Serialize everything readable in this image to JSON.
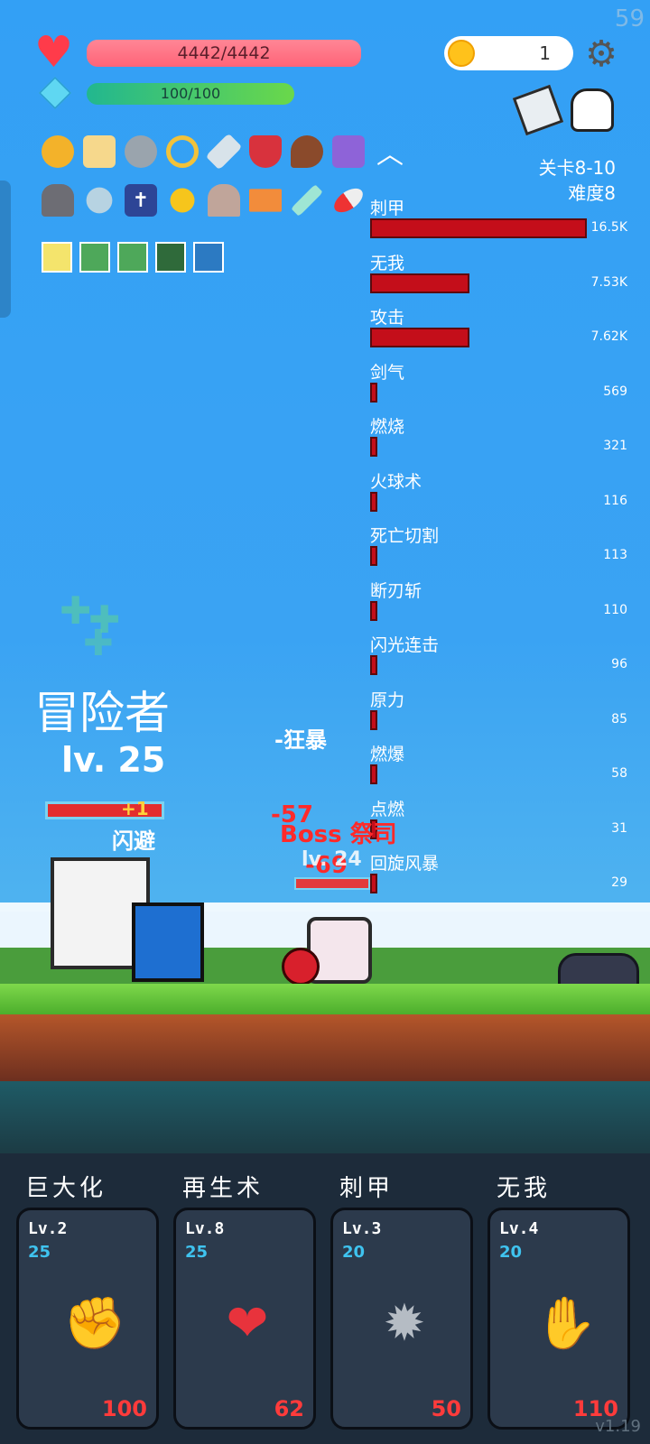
{
  "fps": "59",
  "player": {
    "hp_text": "4442/4442",
    "mp_text": "100/100",
    "hp_fraction": 1.0,
    "mp_fraction": 1.0
  },
  "coins": "1",
  "stage": {
    "level": "关卡8-10",
    "difficulty": "难度8"
  },
  "equipment_row1": [
    "coin-stack-icon",
    "scroll-icon",
    "spiked-mace-icon",
    "ring-icon",
    "sword-icon",
    "shield-icon",
    "drumstick-icon",
    "treasure-chest-icon",
    "collapse-chevron-icon"
  ],
  "equipment_row2": [
    "helmet-icon",
    "clover-icon",
    "holy-book-icon",
    "sun-orb-icon",
    "tombstone-icon",
    "crown-icon",
    "dagger-icon",
    "pill-icon"
  ],
  "buff_icons": [
    "light-burst-icon",
    "sprout-icon",
    "sprout-icon",
    "wind-swirl-icon",
    "sparkle-icon"
  ],
  "damage_stats": [
    {
      "name": "刺甲",
      "value": "16.5K",
      "fraction": 1.0
    },
    {
      "name": "无我",
      "value": "7.53K",
      "fraction": 0.46
    },
    {
      "name": "攻击",
      "value": "7.62K",
      "fraction": 0.46
    },
    {
      "name": "剑气",
      "value": "569",
      "fraction": 0.035
    },
    {
      "name": "燃烧",
      "value": "321",
      "fraction": 0.02
    },
    {
      "name": "火球术",
      "value": "116",
      "fraction": 0.007
    },
    {
      "name": "死亡切割",
      "value": "113",
      "fraction": 0.007
    },
    {
      "name": "断刃斩",
      "value": "110",
      "fraction": 0.007
    },
    {
      "name": "闪光连击",
      "value": "96",
      "fraction": 0.006
    },
    {
      "name": "原力",
      "value": "85",
      "fraction": 0.005
    },
    {
      "name": "燃爆",
      "value": "58",
      "fraction": 0.004
    },
    {
      "name": "点燃",
      "value": "31",
      "fraction": 0.002
    },
    {
      "name": "回旋风暴",
      "value": "29",
      "fraction": 0.002
    }
  ],
  "hero": {
    "name": "冒险者",
    "level": "lv. 25",
    "status": "闪避",
    "heal": "+1"
  },
  "combat_texts": {
    "rage": "-狂暴",
    "dmg1": "-57",
    "dmg2": "-69",
    "enemy_tag": "Boss 祭司",
    "enemy_lv": "lv. 24"
  },
  "skills": [
    {
      "title": "巨大化",
      "lv": "Lv.2",
      "cost": "25",
      "price": "100",
      "icon": "fist-icon"
    },
    {
      "title": "再生术",
      "lv": "Lv.8",
      "cost": "25",
      "price": "62",
      "icon": "winged-heart-icon"
    },
    {
      "title": "刺甲",
      "lv": "Lv.3",
      "cost": "20",
      "price": "50",
      "icon": "spiked-ball-icon"
    },
    {
      "title": "无我",
      "lv": "Lv.4",
      "cost": "20",
      "price": "110",
      "icon": "eye-hand-icon"
    }
  ],
  "version": "v1.19"
}
